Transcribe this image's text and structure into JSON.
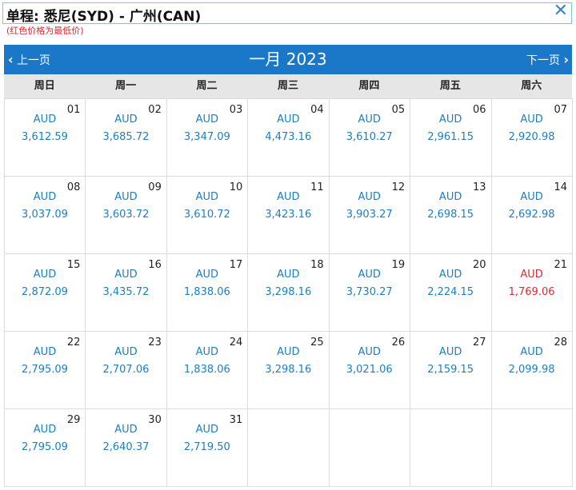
{
  "header": {
    "title": "单程: 悉尼(SYD) - 广州(CAN)",
    "note": "(红色价格为最低价)",
    "close_icon": "close-icon"
  },
  "nav": {
    "prev_label": "上一页",
    "next_label": "下一页",
    "month_label": "一月 2023",
    "bar_color": "#1b78c8"
  },
  "weekdays": [
    "周日",
    "周一",
    "周二",
    "周三",
    "周四",
    "周五",
    "周六"
  ],
  "colors": {
    "price": "#1a7fc4",
    "lowest": "#e0282f"
  },
  "days": [
    {
      "day": "01",
      "currency": "AUD",
      "price": "3,612.59",
      "lowest": false
    },
    {
      "day": "02",
      "currency": "AUD",
      "price": "3,685.72",
      "lowest": false
    },
    {
      "day": "03",
      "currency": "AUD",
      "price": "3,347.09",
      "lowest": false
    },
    {
      "day": "04",
      "currency": "AUD",
      "price": "4,473.16",
      "lowest": false
    },
    {
      "day": "05",
      "currency": "AUD",
      "price": "3,610.27",
      "lowest": false
    },
    {
      "day": "06",
      "currency": "AUD",
      "price": "2,961.15",
      "lowest": false
    },
    {
      "day": "07",
      "currency": "AUD",
      "price": "2,920.98",
      "lowest": false
    },
    {
      "day": "08",
      "currency": "AUD",
      "price": "3,037.09",
      "lowest": false
    },
    {
      "day": "09",
      "currency": "AUD",
      "price": "3,603.72",
      "lowest": false
    },
    {
      "day": "10",
      "currency": "AUD",
      "price": "3,610.72",
      "lowest": false
    },
    {
      "day": "11",
      "currency": "AUD",
      "price": "3,423.16",
      "lowest": false
    },
    {
      "day": "12",
      "currency": "AUD",
      "price": "3,903.27",
      "lowest": false
    },
    {
      "day": "13",
      "currency": "AUD",
      "price": "2,698.15",
      "lowest": false
    },
    {
      "day": "14",
      "currency": "AUD",
      "price": "2,692.98",
      "lowest": false
    },
    {
      "day": "15",
      "currency": "AUD",
      "price": "2,872.09",
      "lowest": false
    },
    {
      "day": "16",
      "currency": "AUD",
      "price": "3,435.72",
      "lowest": false
    },
    {
      "day": "17",
      "currency": "AUD",
      "price": "1,838.06",
      "lowest": false
    },
    {
      "day": "18",
      "currency": "AUD",
      "price": "3,298.16",
      "lowest": false
    },
    {
      "day": "19",
      "currency": "AUD",
      "price": "3,730.27",
      "lowest": false
    },
    {
      "day": "20",
      "currency": "AUD",
      "price": "2,224.15",
      "lowest": false
    },
    {
      "day": "21",
      "currency": "AUD",
      "price": "1,769.06",
      "lowest": true
    },
    {
      "day": "22",
      "currency": "AUD",
      "price": "2,795.09",
      "lowest": false
    },
    {
      "day": "23",
      "currency": "AUD",
      "price": "2,707.06",
      "lowest": false
    },
    {
      "day": "24",
      "currency": "AUD",
      "price": "1,838.06",
      "lowest": false
    },
    {
      "day": "25",
      "currency": "AUD",
      "price": "3,298.16",
      "lowest": false
    },
    {
      "day": "26",
      "currency": "AUD",
      "price": "3,021.06",
      "lowest": false
    },
    {
      "day": "27",
      "currency": "AUD",
      "price": "2,159.15",
      "lowest": false
    },
    {
      "day": "28",
      "currency": "AUD",
      "price": "2,099.98",
      "lowest": false
    },
    {
      "day": "29",
      "currency": "AUD",
      "price": "2,795.09",
      "lowest": false
    },
    {
      "day": "30",
      "currency": "AUD",
      "price": "2,640.37",
      "lowest": false
    },
    {
      "day": "31",
      "currency": "AUD",
      "price": "2,719.50",
      "lowest": false
    }
  ]
}
